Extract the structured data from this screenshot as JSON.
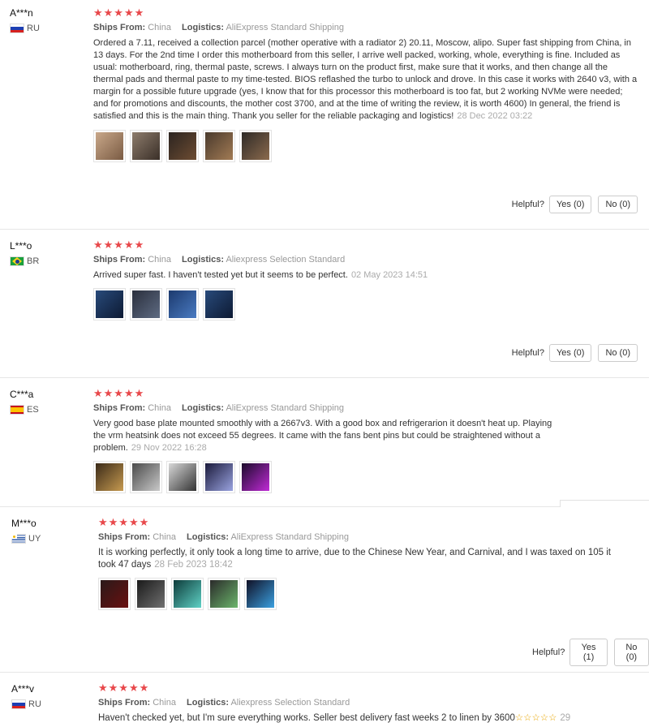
{
  "reviews": [
    {
      "user": "A***n",
      "country": "RU",
      "stars": "★★★★★",
      "ships_from_label": "Ships From:",
      "ships_from": "China",
      "logistics_label": "Logistics:",
      "logistics": "AliExpress Standard Shipping",
      "text": "Ordered a 7.11, received a collection parcel (mother operative with a radiator 2) 20.11, Moscow, alipo. Super fast shipping from China, in 13 days. For the 2nd time I order this motherboard from this seller, I arrive well packed, working, whole, everything is fine. Included as usual: motherboard, ring, thermal paste, screws. I always turn on the product first, make sure that it works, and then change all the thermal pads and thermal paste to my time-tested. BIOS reflashed the turbo to unlock and drove. In this case it works with 2640 v3, with a margin for a possible future upgrade (yes, I know that for this processor this motherboard is too fat, but 2 working NVMe were needed; and for promotions and discounts, the mother cost 3700, and at the time of writing the review, it is worth 4600) In general, the friend is satisfied and this is the main thing. Thank you seller for the reliable packaging and logistics!",
      "date": "28 Dec 2022 03:22",
      "helpful_label": "Helpful?",
      "yes_label": "Yes (0)",
      "no_label": "No (0)"
    },
    {
      "user": "L***o",
      "country": "BR",
      "stars": "★★★★★",
      "ships_from_label": "Ships From:",
      "ships_from": "China",
      "logistics_label": "Logistics:",
      "logistics": "Aliexpress Selection Standard",
      "text": "Arrived super fast. I haven't tested yet but it seems to be perfect.",
      "date": "02 May 2023 14:51",
      "helpful_label": "Helpful?",
      "yes_label": "Yes (0)",
      "no_label": "No (0)"
    },
    {
      "user": "C***a",
      "country": "ES",
      "stars": "★★★★★",
      "ships_from_label": "Ships From:",
      "ships_from": "China",
      "logistics_label": "Logistics:",
      "logistics": "AliExpress Standard Shipping",
      "text": "Very good base plate mounted smoothly with a 2667v3. With a good box and refrigerarion it doesn't heat up. Playing the vrm heatsink does not exceed 55 degrees. It came with the fans bent pins but could be straightened without a problem.",
      "date": "29 Nov 2022 16:28"
    },
    {
      "user": "M***o",
      "country": "UY",
      "stars": "★★★★★",
      "ships_from_label": "Ships From:",
      "ships_from": "China",
      "logistics_label": "Logistics:",
      "logistics": "AliExpress Standard Shipping",
      "text": "It is working perfectly, it only took a long time to arrive, due to the Chinese New Year, and Carnival, and I was taxed on 105 it took 47 days",
      "date": "28 Feb 2023 18:42",
      "helpful_label": "Helpful?",
      "yes_label": "Yes (1)",
      "no_label": "No (0)"
    },
    {
      "user": "A***v",
      "country": "RU",
      "stars": "★★★★★",
      "ships_from_label": "Ships From:",
      "ships_from": "China",
      "logistics_label": "Logistics:",
      "logistics": "Aliexpress Selection Standard",
      "text": "Haven't checked yet, but I'm sure everything works. Seller best delivery fast weeks 2 to linen by 3600",
      "inline_stars": "☆☆☆☆☆",
      "inline_count": "29"
    }
  ],
  "colors": {
    "star": "#e8484b",
    "meta_gray": "#999999",
    "date_gray": "#aaaaaa",
    "divider": "#e6e6e6"
  }
}
